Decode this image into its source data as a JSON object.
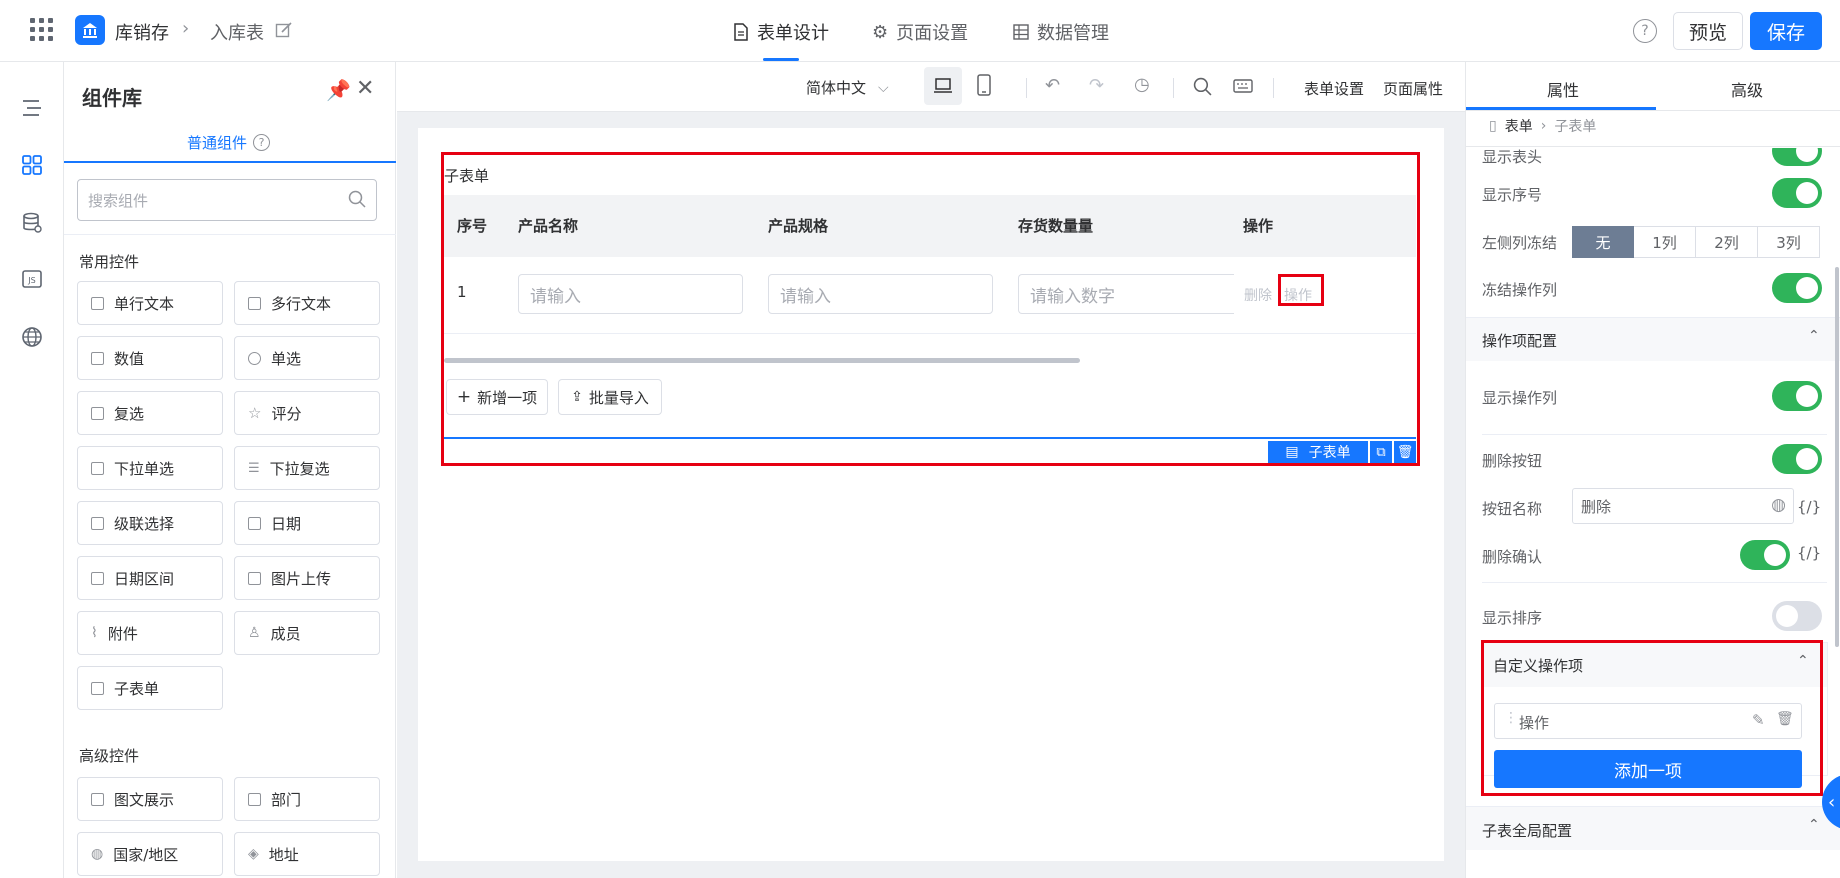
{
  "header": {
    "app_name": "库销存",
    "page_name": "入库表",
    "tabs": [
      {
        "label": "表单设计",
        "icon": "document-icon"
      },
      {
        "label": "页面设置",
        "icon": "gear-icon"
      },
      {
        "label": "数据管理",
        "icon": "table-icon"
      }
    ],
    "preview_label": "预览",
    "save_label": "保存",
    "help_symbol": "?"
  },
  "library": {
    "title": "组件库",
    "tab_label": "普通组件",
    "search_placeholder": "搜索组件",
    "common_title": "常用控件",
    "common": [
      "单行文本",
      "多行文本",
      "数值",
      "单选",
      "复选",
      "评分",
      "下拉单选",
      "下拉复选",
      "级联选择",
      "日期",
      "日期区间",
      "图片上传",
      "附件",
      "成员",
      "子表单"
    ],
    "advanced_title": "高级控件",
    "advanced": [
      "图文展示",
      "部门",
      "国家/地区",
      "地址"
    ]
  },
  "toolbar": {
    "language": "简体中文",
    "form_settings": "表单设置",
    "page_attrs": "页面属性"
  },
  "subform": {
    "title": "子表单",
    "columns": [
      "序号",
      "产品名称",
      "产品规格",
      "存货数量量",
      "操作"
    ],
    "row_index": "1",
    "placeholder_text": "请输入",
    "placeholder_number": "请输入数字",
    "delete_label": "删除",
    "action_label": "操作",
    "add_item": "新增一项",
    "batch_import": "批量导入",
    "badge_label": "子表单"
  },
  "panel": {
    "tabs": [
      "属性",
      "高级"
    ],
    "breadcrumb_root": "表单",
    "breadcrumb_current": "子表单",
    "show_header": "显示表头",
    "show_index": "显示序号",
    "left_freeze": "左侧列冻结",
    "freeze_options": [
      "无",
      "1列",
      "2列",
      "3列"
    ],
    "freeze_selected": "无",
    "freeze_action_col": "冻结操作列",
    "action_config_title": "操作项配置",
    "show_action_col": "显示操作列",
    "delete_button": "删除按钮",
    "button_name_label": "按钮名称",
    "button_name_value": "删除",
    "delete_confirm": "删除确认",
    "show_sort": "显示排序",
    "custom_actions_title": "自定义操作项",
    "custom_action_item": "操作",
    "add_one": "添加一项",
    "global_config_title": "子表全局配置",
    "expr_symbol": "{/}"
  }
}
